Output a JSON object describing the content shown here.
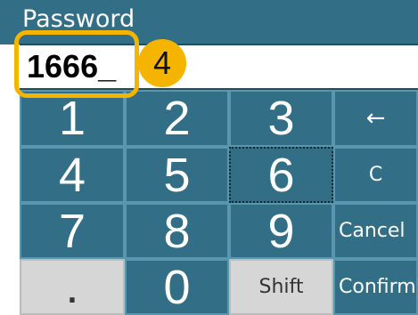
{
  "dialog": {
    "title": "Password",
    "entry_value": "1666_"
  },
  "keypad": {
    "rows": [
      [
        "1",
        "2",
        "3",
        "←"
      ],
      [
        "4",
        "5",
        "6",
        "C"
      ],
      [
        "7",
        "8",
        "9",
        "Cancel"
      ],
      [
        ".",
        "0",
        "Shift",
        "Confirm"
      ]
    ],
    "focused_key": "6"
  },
  "annotation": {
    "step": "4"
  },
  "colors": {
    "key_background": "#326f86",
    "key_border": "#5a96ad",
    "keypad_gap": "#1e4e5e",
    "light_key": "#d6d6d6",
    "annotation": "#f5b400"
  }
}
